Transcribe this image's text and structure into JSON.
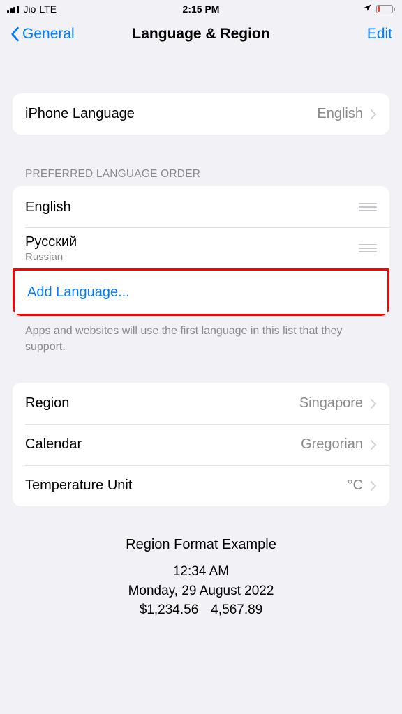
{
  "status": {
    "carrier": "Jio",
    "network": "LTE",
    "time": "2:15 PM"
  },
  "nav": {
    "back_label": "General",
    "title": "Language & Region",
    "edit_label": "Edit"
  },
  "iphone_language": {
    "label": "iPhone Language",
    "value": "English"
  },
  "preferred": {
    "header": "PREFERRED LANGUAGE ORDER",
    "items": [
      {
        "native": "English",
        "sub": ""
      },
      {
        "native": "Русский",
        "sub": "Russian"
      }
    ],
    "add_label": "Add Language...",
    "footer": "Apps and websites will use the first language in this list that they support."
  },
  "region_settings": {
    "rows": [
      {
        "label": "Region",
        "value": "Singapore"
      },
      {
        "label": "Calendar",
        "value": "Gregorian"
      },
      {
        "label": "Temperature Unit",
        "value": "°C"
      }
    ]
  },
  "example": {
    "title": "Region Format Example",
    "time": "12:34 AM",
    "date": "Monday, 29 August 2022",
    "money": "$1,234.56",
    "number": "4,567.89"
  }
}
